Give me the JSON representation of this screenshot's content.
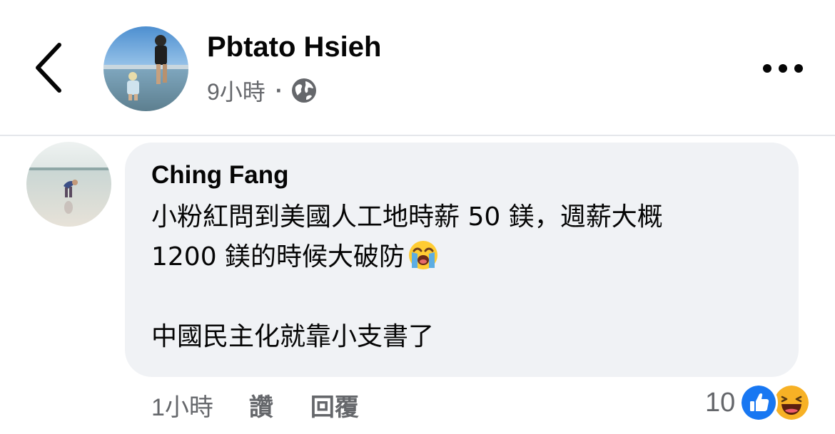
{
  "header": {
    "poster_name": "Pbtato Hsieh",
    "post_time": "9小時",
    "separator": "·",
    "audience_icon": "globe-icon",
    "back_icon": "chevron-left-icon",
    "more_icon": "more-dots-icon"
  },
  "comment": {
    "author": "Ching Fang",
    "text_line1": "小粉紅問到美國人工地時薪 50 鎂，週薪大概",
    "text_line2": "1200 鎂的時候大破防",
    "text_emoji": "loudly-crying-face-icon",
    "text_line4": "中國民主化就靠小支書了"
  },
  "footer": {
    "time": "1小時",
    "like_label": "讚",
    "reply_label": "回覆",
    "reaction_count": "10",
    "reactions": [
      "like-icon",
      "haha-icon"
    ]
  },
  "colors": {
    "bubble_bg": "#f0f2f5",
    "secondary_text": "#65676b",
    "primary_text": "#050505",
    "like_blue": "#1877f2",
    "haha_yellow": "#f7b125"
  }
}
